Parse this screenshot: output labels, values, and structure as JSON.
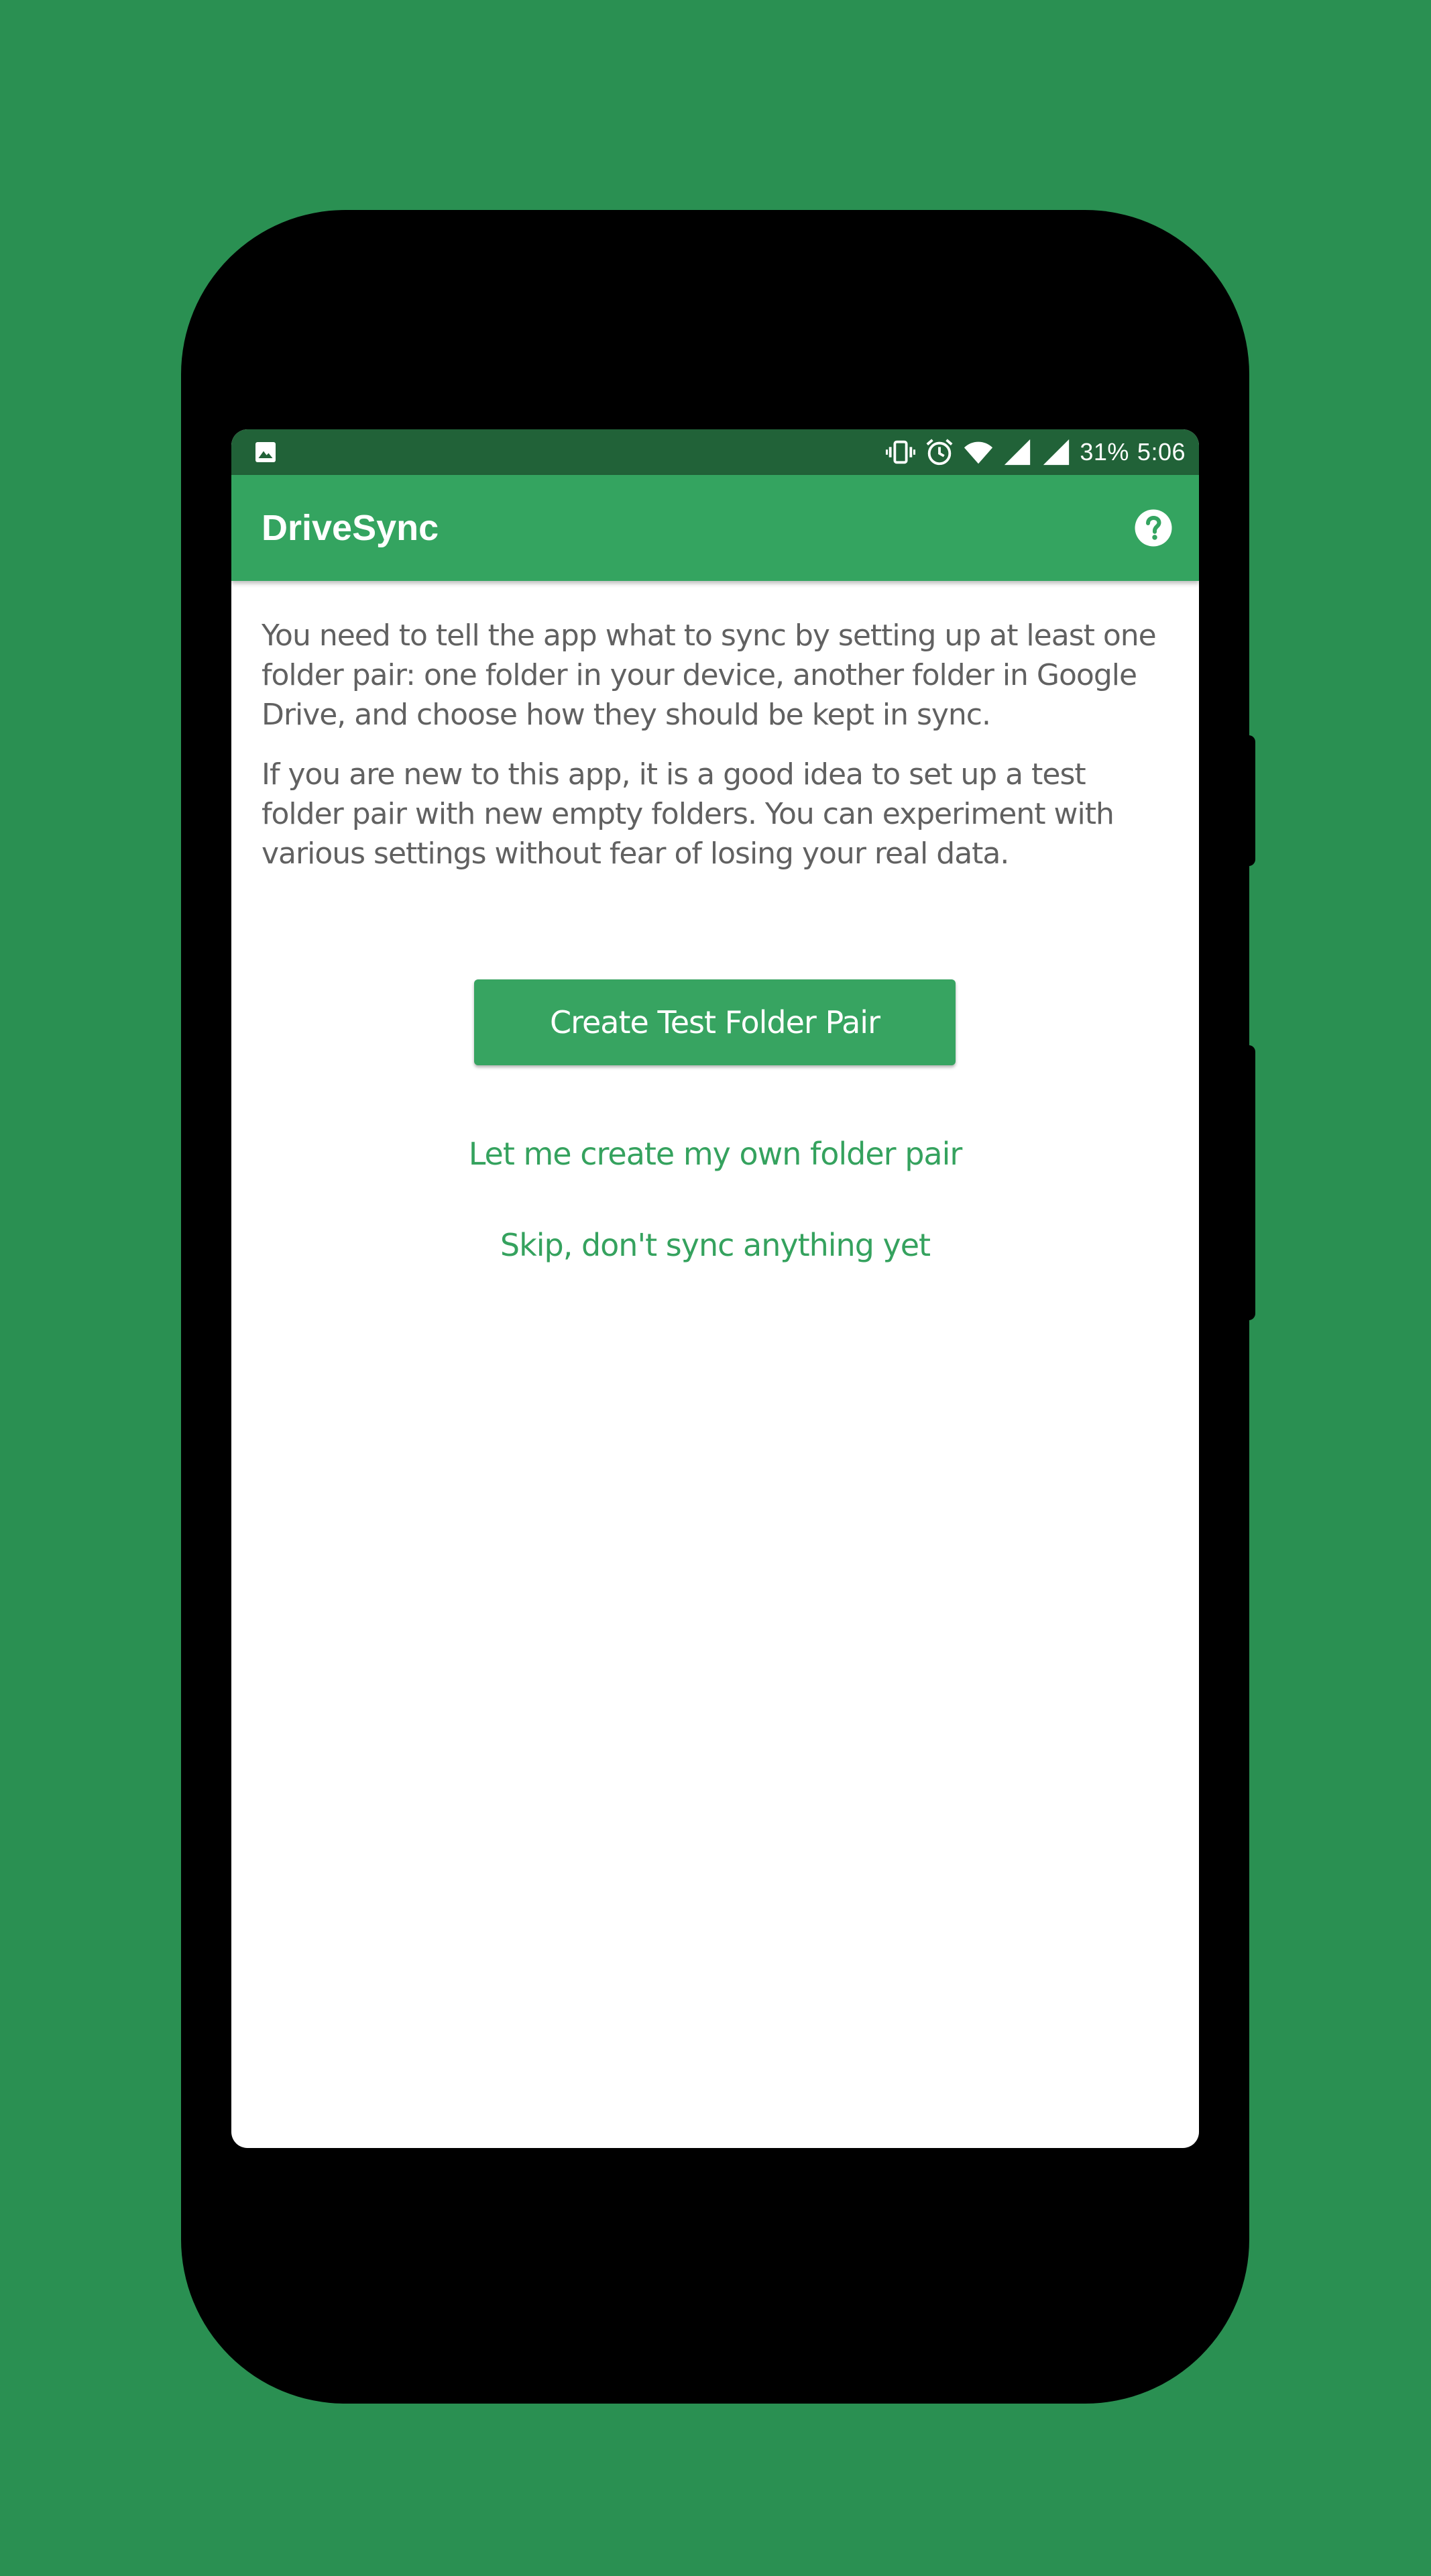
{
  "colors": {
    "background": "#2a9052",
    "phone_body": "#000000",
    "status_bar": "#216238",
    "app_bar": "#34a460",
    "primary_button": "#37a461",
    "accent_text": "#35a25e",
    "body_text": "#616161"
  },
  "status_bar": {
    "left_icon": "image-icon",
    "icons": [
      "vibrate-icon",
      "alarm-icon",
      "wifi-icon",
      "signal-icon",
      "signal-icon"
    ],
    "battery": "31%",
    "time": "5:06"
  },
  "app_bar": {
    "title": "DriveSync",
    "help_icon": "help-circle-icon"
  },
  "main": {
    "paragraph_1": "You need to tell the app what to sync by setting up at least one folder pair: one folder in your device, another folder in Google Drive, and choose how they should be kept in sync.",
    "paragraph_2": "If you are new to this app, it is a good idea to set up a test folder pair with new empty folders. You can experiment with various settings without fear of losing your real data.",
    "create_test_button": "Create Test Folder Pair",
    "create_own_link": "Let me create my own folder pair",
    "skip_link": "Skip, don't sync anything yet"
  }
}
